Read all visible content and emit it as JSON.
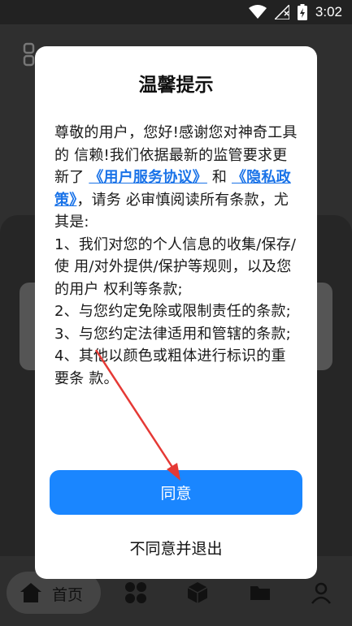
{
  "status_bar": {
    "time": "3:02",
    "icons": [
      "wifi-icon",
      "signal-icon",
      "battery-charging-icon"
    ]
  },
  "bottom_nav": {
    "items": [
      {
        "label": "首页",
        "icon": "home-icon",
        "active": true
      },
      {
        "label": "",
        "icon": "apps-grid-icon"
      },
      {
        "label": "",
        "icon": "cube-icon"
      },
      {
        "label": "",
        "icon": "folder-icon"
      },
      {
        "label": "",
        "icon": "profile-icon"
      }
    ]
  },
  "dialog": {
    "title": "温馨提示",
    "intro_1": "尊敬的用户，您好!感谢您对神奇工具的 信赖!我们依据最新的监管要求更新了",
    "link_terms": "《用户服务协议》",
    "and": "和",
    "link_privacy": "《隐私政策》",
    "intro_2": "，请务 必审慎阅读所有条款，尤其是:",
    "item_1": "1、我们对您的个人信息的收集/保存/使 用/对外提供/保护等规则，以及您的用户 权利等条款;",
    "item_2": "2、与您约定免除或限制责任的条款;",
    "item_3": "3、与您约定法律适用和管辖的条款;",
    "item_4": "4、其他以颜色或粗体进行标识的重要条 款。",
    "agree_label": "同意",
    "disagree_label": "不同意并退出"
  },
  "colors": {
    "accent": "#1a86ff",
    "link": "#1a73e8",
    "annotation_arrow": "#e53935"
  }
}
